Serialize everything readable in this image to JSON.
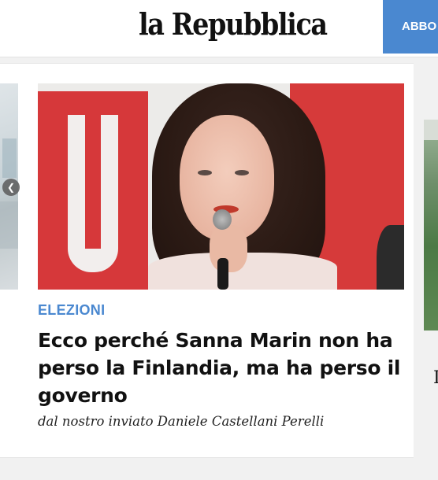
{
  "header": {
    "logo": "la Repubblica",
    "subscribe_label": "ABBO"
  },
  "carousel": {
    "prev_arrow_icon": "chevron-left-icon",
    "featured": {
      "section": "ELEZIONI",
      "headline": "Ecco perché Sanna Marin non ha perso la Finlandia, ma ha perso il governo",
      "byline": "dal nostro inviato Daniele Castellani Perelli"
    },
    "next_preview_text": "I"
  },
  "colors": {
    "brand_blue": "#4a88d0",
    "headline": "#111111",
    "background": "#f1f1f1"
  }
}
